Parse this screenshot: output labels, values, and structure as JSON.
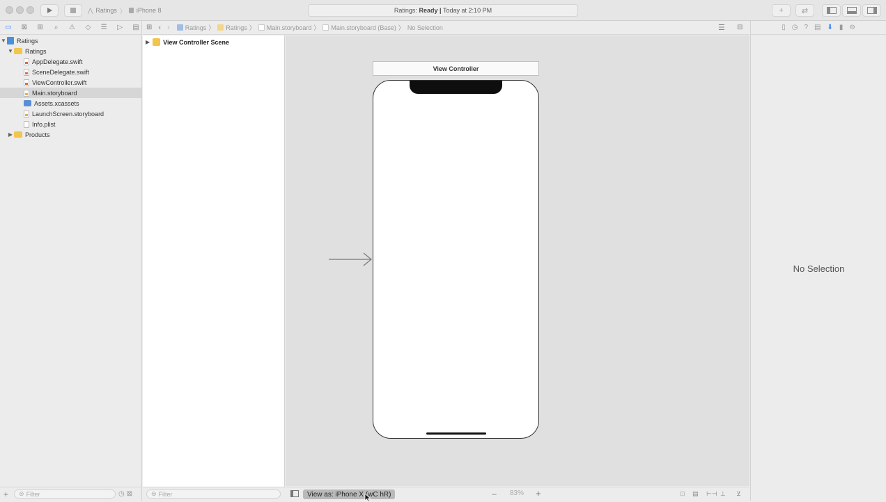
{
  "toolbar": {
    "scheme": {
      "target": "Ratings",
      "device": "iPhone 8"
    },
    "activity": {
      "prefix": "Ratings:",
      "status": "Ready",
      "separator": "|",
      "time": "Today at 2:10 PM"
    },
    "run_icon": "play-icon",
    "stop_icon": "stop-icon"
  },
  "navigator": {
    "tabs": [
      "folder-icon",
      "source-control-icon",
      "symbol-icon",
      "find-icon",
      "issue-icon",
      "test-icon",
      "debug-icon",
      "breakpoint-icon",
      "report-icon"
    ],
    "items": [
      {
        "label": "Ratings",
        "kind": "project",
        "expanded": true
      },
      {
        "label": "Ratings",
        "kind": "folder",
        "expanded": true
      },
      {
        "label": "AppDelegate.swift",
        "kind": "swift"
      },
      {
        "label": "SceneDelegate.swift",
        "kind": "swift"
      },
      {
        "label": "ViewController.swift",
        "kind": "swift"
      },
      {
        "label": "Main.storyboard",
        "kind": "storyboard",
        "selected": true
      },
      {
        "label": "Assets.xcassets",
        "kind": "assets"
      },
      {
        "label": "LaunchScreen.storyboard",
        "kind": "storyboard"
      },
      {
        "label": "Info.plist",
        "kind": "plist"
      },
      {
        "label": "Products",
        "kind": "folder",
        "expanded": false
      }
    ],
    "filter_placeholder": "Filter"
  },
  "jumpbar": {
    "crumbs": [
      "Ratings",
      "Ratings",
      "Main.storyboard",
      "Main.storyboard (Base)",
      "No Selection"
    ]
  },
  "outline": {
    "scene_label": "View Controller Scene",
    "filter_placeholder": "Filter"
  },
  "canvas": {
    "vc_title": "View Controller",
    "device_frame": "iPhone XR notch frame"
  },
  "canvas_bar": {
    "view_as": "View as: iPhone X",
    "view_as_traits": "(wC hR)",
    "zoom": "83%"
  },
  "inspector": {
    "tabs": [
      "file-icon",
      "history-icon",
      "help-icon",
      "identity-icon",
      "attributes-icon",
      "size-icon",
      "connections-icon"
    ],
    "empty_text": "No Selection"
  },
  "colors": {
    "accent": "#3b82f6",
    "folder": "#f2c54d",
    "swift": "#e8673d"
  }
}
